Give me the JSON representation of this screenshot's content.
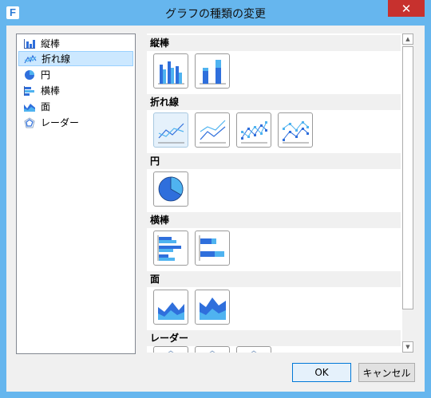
{
  "window": {
    "title": "グラフの種類の変更",
    "app_icon_letter": "F"
  },
  "chart_types": [
    {
      "label": "縦棒",
      "icon": "column-chart-icon"
    },
    {
      "label": "折れ線",
      "icon": "line-chart-icon",
      "selected": true
    },
    {
      "label": "円",
      "icon": "pie-chart-icon"
    },
    {
      "label": "横棒",
      "icon": "bar-chart-icon"
    },
    {
      "label": "面",
      "icon": "area-chart-icon"
    },
    {
      "label": "レーダー",
      "icon": "radar-chart-icon"
    }
  ],
  "gallery": {
    "sections": [
      {
        "title": "縦棒",
        "thumbnails": [
          "clustered-column",
          "stacked-column"
        ]
      },
      {
        "title": "折れ線",
        "thumbnails": [
          "line",
          "stacked-line",
          "line-with-markers",
          "stacked-line-with-markers"
        ],
        "selected_index": 0
      },
      {
        "title": "円",
        "thumbnails": [
          "pie"
        ]
      },
      {
        "title": "横棒",
        "thumbnails": [
          "clustered-bar",
          "stacked-bar"
        ]
      },
      {
        "title": "面",
        "thumbnails": [
          "area",
          "stacked-area"
        ]
      },
      {
        "title": "レーダー",
        "thumbnails": [
          "radar",
          "radar-with-markers",
          "filled-radar"
        ]
      }
    ]
  },
  "buttons": {
    "ok": "OK",
    "cancel": "キャンセル"
  },
  "colors": {
    "accent": "#2f6fdc",
    "light_series": "#4fb3f0",
    "selection": "#cce8ff"
  }
}
